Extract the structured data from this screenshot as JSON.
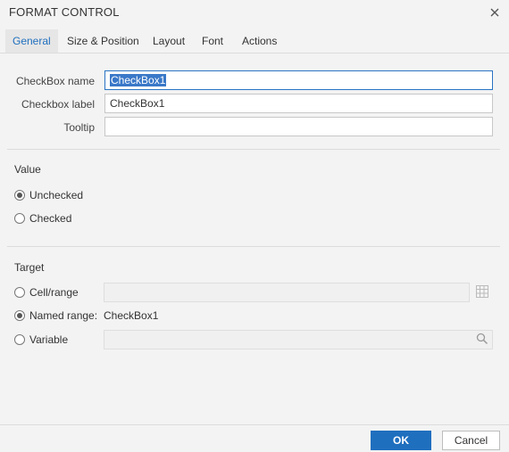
{
  "dialog": {
    "title": "FORMAT CONTROL"
  },
  "tabs": [
    {
      "label": "General",
      "active": true
    },
    {
      "label": "Size & Position",
      "active": false
    },
    {
      "label": "Layout",
      "active": false
    },
    {
      "label": "Font",
      "active": false
    },
    {
      "label": "Actions",
      "active": false
    }
  ],
  "general": {
    "checkbox_name_label": "CheckBox name",
    "checkbox_name_value": "CheckBox1",
    "checkbox_label_label": "Checkbox label",
    "checkbox_label_value": "CheckBox1",
    "tooltip_label": "Tooltip",
    "tooltip_value": ""
  },
  "value_section": {
    "title": "Value",
    "options": [
      {
        "label": "Unchecked",
        "selected": true
      },
      {
        "label": "Checked",
        "selected": false
      }
    ]
  },
  "target_section": {
    "title": "Target",
    "cell_range_label": "Cell/range",
    "cell_range_value": "",
    "named_range_label": "Named range:",
    "named_range_value": "CheckBox1",
    "variable_label": "Variable",
    "variable_value": "",
    "selected": "named_range"
  },
  "buttons": {
    "ok": "OK",
    "cancel": "Cancel"
  },
  "icons": {
    "close": "close-icon",
    "grid": "grid-icon",
    "search": "search-icon"
  },
  "colors": {
    "accent": "#1f6fbf",
    "selection": "#3a78c8"
  }
}
